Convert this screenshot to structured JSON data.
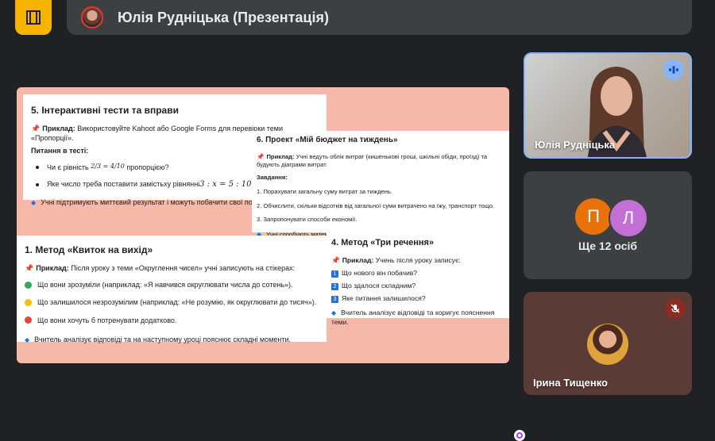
{
  "meeting": {
    "title": "Юлія Рудніцька (Презентація)"
  },
  "slide": {
    "card1": {
      "heading": "5. Інтерактивні тести та вправи",
      "example_label": "Приклад:",
      "example_text": "Використовуйте Kahoot або Google Forms для перевірки теми «Пропорції».",
      "questions_label": "Питання в тесті:",
      "q1_a": "Чи є рівність",
      "q1_math": "2/3 = 4/10",
      "q1_b": "пропорцією?",
      "q2_a": "Яке число треба поставити замістьxy рівнянні",
      "q2_math": "3 : x = 5 : 10",
      "q2_b": "?",
      "footer": "Учні підтримують миттєвий результат і можуть побачити свої по"
    },
    "card2": {
      "heading": "6. Проект «Мій бюджет на тиждень»",
      "example_label": "Приклад:",
      "example_text": "Учні ведуть облік витрат (кишенькові гроші, шкільні обіди, проїзд) та будують діаграми витрат.",
      "tasks_label": "Завдання:",
      "tasks": [
        "1.  Порахувати загальну суму витрат за тиждень.",
        "2.  Обчислити, скільки відсотків від загальної суми витрачено на їжу, транспорт тощо.",
        "3.  Запропонувати способи економії."
      ],
      "footer": "Учні спробують математичні навички в реальному житті."
    },
    "card3": {
      "heading": "1. Метод «Квиток на вихід»",
      "example_label": "Приклад:",
      "example_text": "Після уроку з теми «Округлення чисел» учні записують на стікерах:",
      "items": [
        {
          "color": "#34a853",
          "text": "Що вони зрозуміли (наприклад: «Я навчився округлювати числа до сотень»)."
        },
        {
          "color": "#fbbc04",
          "text": "Що залишилося незрозумілим (наприклад: «Не розумію, як округлювати до тисяч»)."
        },
        {
          "color": "#ea4335",
          "text": "Що вони хочуть б потренувати додатково."
        }
      ],
      "footer": "Вчитель аналізує відповіді та на наступному уроці пояснює складні моменти."
    },
    "card4": {
      "heading": "4. Метод «Три речення»",
      "example_label": "Приклад:",
      "example_text": "Учень після уроку записує:",
      "items": [
        {
          "num": "1",
          "text": "Що нового він побачив?"
        },
        {
          "num": "2",
          "text": "Що здалося складним?"
        },
        {
          "num": "3",
          "text": "Яке питання залишилося?"
        }
      ],
      "footer": "Вчитель аналізує відповіді та коригує пояснення теми."
    }
  },
  "participants": {
    "speaker": {
      "name": "Юлія Рудніцька",
      "icon": "audio-wave-icon"
    },
    "group": {
      "avatars": [
        {
          "letter": "П",
          "color": "#e8710a"
        },
        {
          "letter": "Л",
          "color": "#c26fd6"
        }
      ],
      "more_label": "Ще 12 осіб"
    },
    "muted": {
      "name": "Ірина Тищенко",
      "icon": "mic-off-icon"
    }
  },
  "colors": {
    "accent": "#8ab4f8",
    "slide_bg": "#f6b8a8",
    "logo": "#f6b400"
  }
}
